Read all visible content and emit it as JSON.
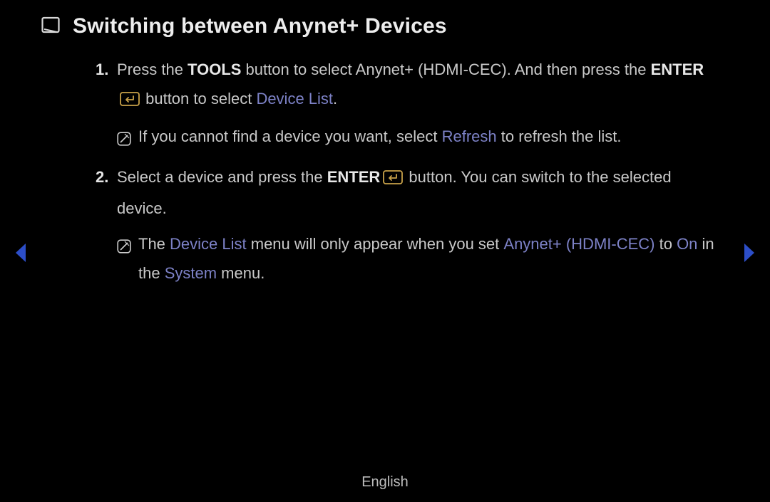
{
  "title": "Switching between Anynet+ Devices",
  "steps": {
    "s1": {
      "num": "1.",
      "t1": "Press the ",
      "tools": "TOOLS",
      "t2": " button to select Anynet+ (HDMI-CEC). And then press the ",
      "enter": "ENTER",
      "t3": " button to select ",
      "deviceList": "Device List",
      "t4": "."
    },
    "note1": {
      "t1": "If you cannot find a device you want, select ",
      "refresh": "Refresh",
      "t2": " to refresh the list."
    },
    "s2": {
      "num": "2.",
      "t1": "Select a device and press the ",
      "enter": "ENTER",
      "t2": " button. You can switch to the selected device."
    },
    "note2": {
      "t1": "The ",
      "deviceList": "Device List",
      "t2": " menu will only appear when you set ",
      "anynet": "Anynet+ (HDMI-CEC)",
      "t3": " to ",
      "on": "On",
      "t4": " in the ",
      "system": "System",
      "t5": " menu."
    }
  },
  "footer": "English"
}
